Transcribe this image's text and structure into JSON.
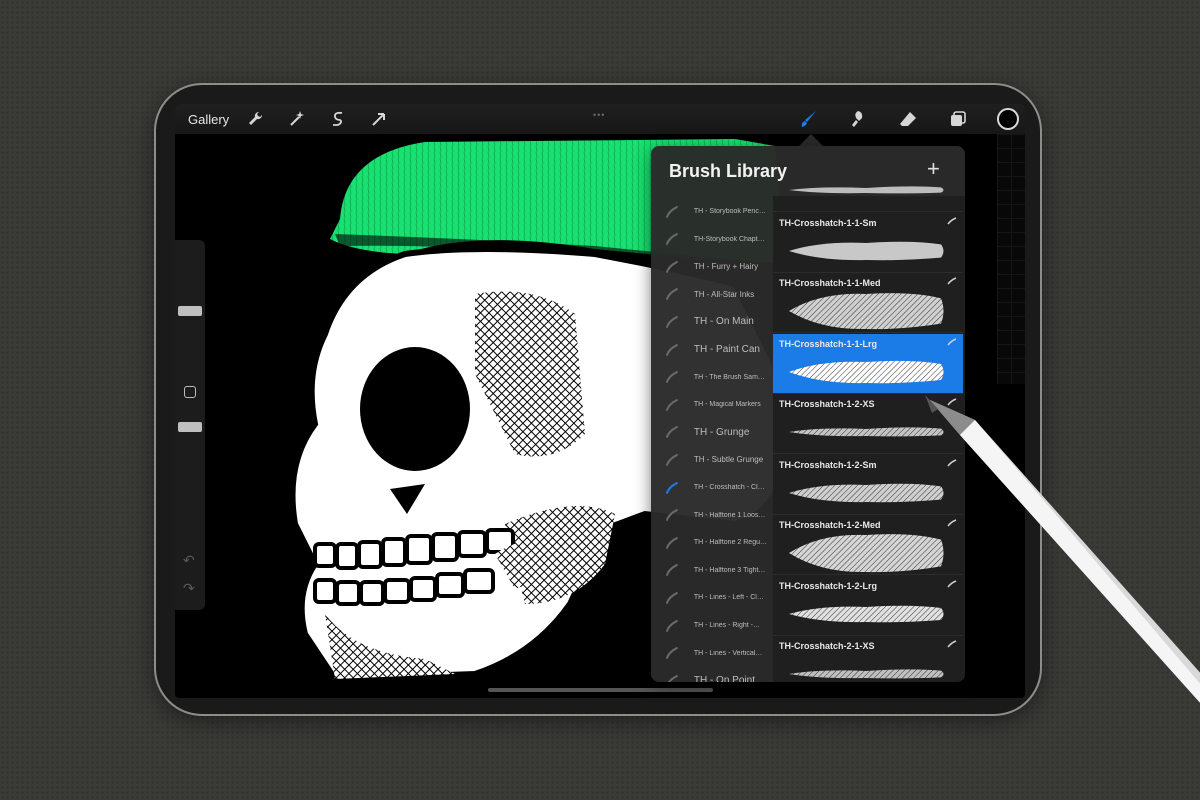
{
  "toolbar": {
    "gallery_label": "Gallery",
    "left_icons": [
      "wrench-icon",
      "magic-wand-icon",
      "selection-icon",
      "transform-arrow-icon"
    ],
    "right_icons": [
      "brush-icon",
      "smudge-icon",
      "eraser-icon",
      "layers-icon",
      "color-well"
    ],
    "active_tool": "brush",
    "active_color": "#1b7ce8"
  },
  "brush_library": {
    "title": "Brush Library",
    "add_label": "+",
    "sets": [
      "TH - Storybook Penc…",
      "TH-Storybook Chapt…",
      "TH - Furry + Hairy",
      "TH - All-Star Inks",
      "TH - On Main",
      "TH - Paint Can",
      "TH - The Brush Sam…",
      "TH - Magical Markers",
      "TH - Grunge",
      "TH - Subtle Grunge",
      "TH - Crosshatch - Cl…",
      "TH - Halftone 1 Loos…",
      "TH - Halftone 2 Regu…",
      "TH - Halftone 3 Tight…",
      "TH - Lines - Left - Cl…",
      "TH - Lines - Right -…",
      "TH - Lines - Vertical…",
      "TH - On Point"
    ],
    "active_set": "TH - Crosshatch - Cl…",
    "brushes": [
      "",
      "TH-Crosshatch-1-1-Sm",
      "TH-Crosshatch-1-1-Med",
      "TH-Crosshatch-1-1-Lrg",
      "TH-Crosshatch-1-2-XS",
      "TH-Crosshatch-1-2-Sm",
      "TH-Crosshatch-1-2-Med",
      "TH-Crosshatch-1-2-Lrg",
      "TH-Crosshatch-2-1-XS"
    ],
    "selected_brush": "TH-Crosshatch-1-1-Lrg"
  },
  "colors": {
    "accent": "#1b7ce8",
    "beanie": "#19e070",
    "canvas": "#000000"
  }
}
